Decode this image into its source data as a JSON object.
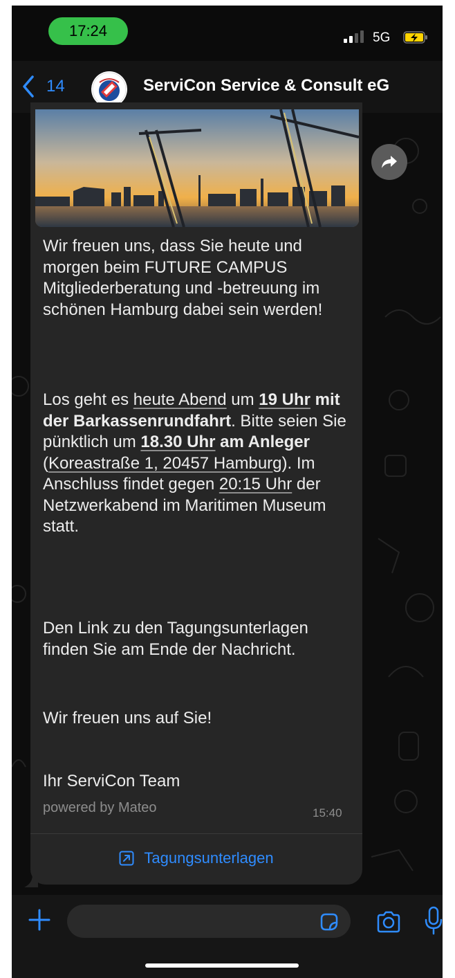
{
  "status_bar": {
    "time": "17:24",
    "network": "5G"
  },
  "header": {
    "back_count": "14",
    "contact_name": "ServiCon Service & Consult eG"
  },
  "message": {
    "p1": "Wir freuen uns, dass Sie heute und morgen beim FUTURE CAMPUS Mitgliederberatung und -betreuung im schönen Hamburg dabei sein werden!",
    "p2": {
      "t1": "Los geht es ",
      "u1": "heute Abend",
      "t2": " um ",
      "b1": "19 Uhr",
      "b2": " mit der Barkassenrundfahrt",
      "t3": ". Bitte seien Sie pünktlich um ",
      "b3": "18.30 Uhr",
      "b4": " am Anleger",
      "t4": " (",
      "u2": "Koreastraße 1, 20457 Hamburg",
      "t5": "). Im Anschluss findet gegen ",
      "u3": "20:15 Uhr",
      "t6": " der Netzwerkabend im Maritimen Museum statt."
    },
    "p3": "Den Link zu den Tagungsunterlagen finden Sie am Ende der Nachricht.",
    "p4": "Wir freuen uns auf Sie!",
    "p5": "Ihr ServiCon Team",
    "footer": "powered by Mateo",
    "time": "15:40",
    "link_label": "Tagungsunterlagen"
  },
  "input": {
    "placeholder": ""
  },
  "icons": {
    "back": "chevron-left-icon",
    "forward": "forward-icon",
    "plus": "plus-icon",
    "sticker": "sticker-icon",
    "camera": "camera-icon",
    "mic": "microphone-icon",
    "link": "external-link-icon"
  },
  "colors": {
    "accent": "#2f8cff",
    "bubble": "#262626",
    "time_pill": "#36c04a",
    "battery": "#ffd400"
  }
}
